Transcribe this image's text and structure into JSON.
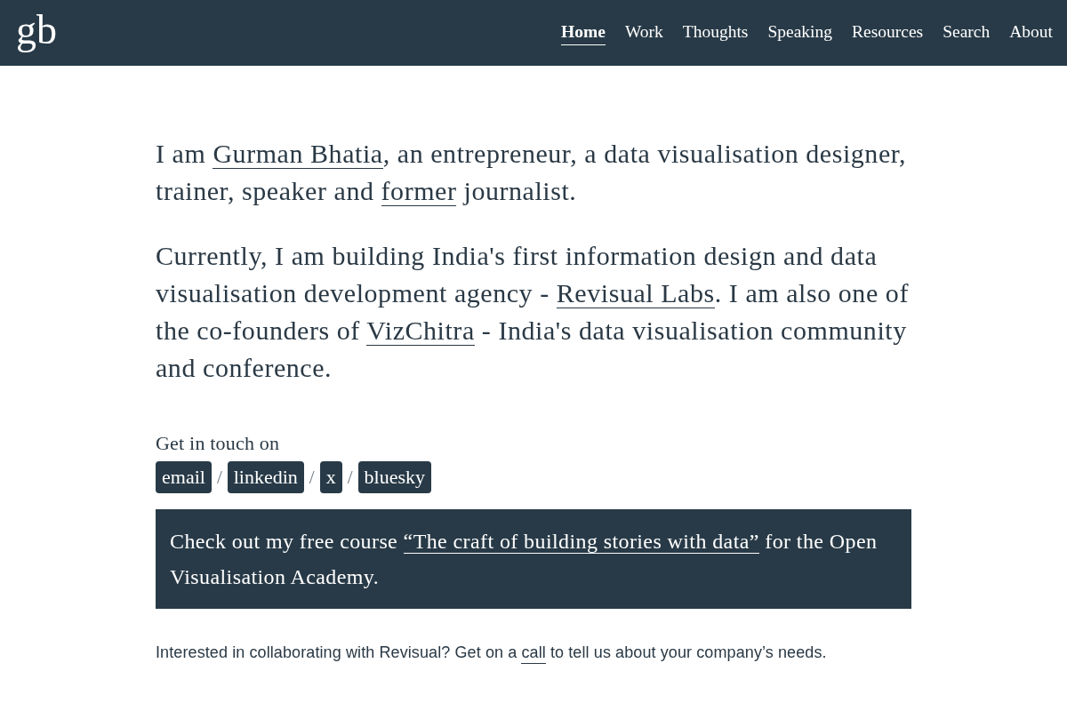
{
  "header": {
    "logo": "gb",
    "nav": [
      {
        "label": "Home",
        "selected": true
      },
      {
        "label": "Work",
        "selected": false
      },
      {
        "label": "Thoughts",
        "selected": false
      },
      {
        "label": "Speaking",
        "selected": false
      },
      {
        "label": "Resources",
        "selected": false
      },
      {
        "label": "Search",
        "selected": false
      },
      {
        "label": "About",
        "selected": false
      }
    ]
  },
  "intro": [
    [
      {
        "kind": "text",
        "text": "I am "
      },
      {
        "kind": "link",
        "text": "Gurman Bhatia"
      },
      {
        "kind": "text",
        "text": ", an entrepreneur, a data visualisation designer, trainer, speaker and "
      },
      {
        "kind": "link",
        "text": "former"
      },
      {
        "kind": "text",
        "text": " journalist."
      }
    ],
    [
      {
        "kind": "text",
        "text": "Currently, I am building India's first information design and data visualisation development agency - "
      },
      {
        "kind": "link",
        "text": "Revisual Labs"
      },
      {
        "kind": "text",
        "text": ". I am also one of the co-founders of "
      },
      {
        "kind": "link",
        "text": "VizChitra"
      },
      {
        "kind": "text",
        "text": " - India's data visualisation community and conference."
      }
    ]
  ],
  "contact": {
    "label": "Get in touch on",
    "links": [
      {
        "label": "email"
      },
      {
        "separator": "/",
        "label": "linkedin"
      },
      {
        "separator": "/",
        "label": "x"
      },
      {
        "separator": "/",
        "label": "bluesky"
      }
    ]
  },
  "course_banner": [
    {
      "kind": "text",
      "text": "Check out my free course "
    },
    {
      "kind": "link",
      "text": "“The craft of building stories with data”"
    },
    {
      "kind": "text",
      "text": " for the Open Visualisation Academy."
    }
  ],
  "collab_note": [
    {
      "kind": "text",
      "text": "Interested in collaborating with Revisual? Get on a "
    },
    {
      "kind": "link",
      "text": "call"
    },
    {
      "kind": "text",
      "text": " to tell us about your company’s needs."
    }
  ]
}
